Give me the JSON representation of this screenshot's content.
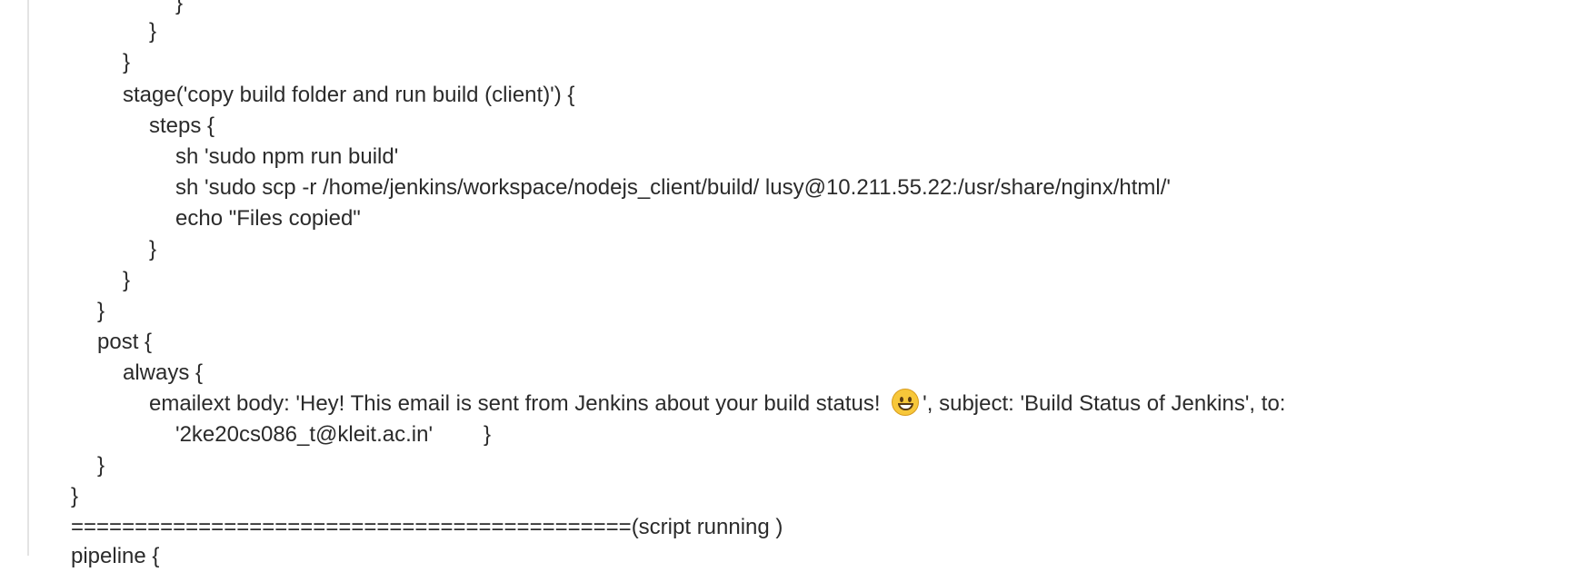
{
  "document": {
    "lines": [
      "}",
      "}",
      "}",
      "stage('copy build folder and run build (client)') {",
      "steps {",
      "sh 'sudo npm run build'",
      "sh 'sudo scp -r /home/jenkins/workspace/nodejs_client/build/ lusy@10.211.55.22:/usr/share/nginx/html/'",
      "echo \"Files copied\"",
      "}",
      "}",
      "}",
      "post {",
      "always {",
      "emailext body: 'Hey! This email is sent from Jenkins about your build status! ",
      "', subject: 'Build Status of Jenkins', to:",
      "'2ke20cs086_t@kleit.ac.in'",
      "}",
      "}",
      "}",
      "============================================(script running )",
      "pipeline {"
    ],
    "emoji_icon": "grinning-face-icon"
  }
}
